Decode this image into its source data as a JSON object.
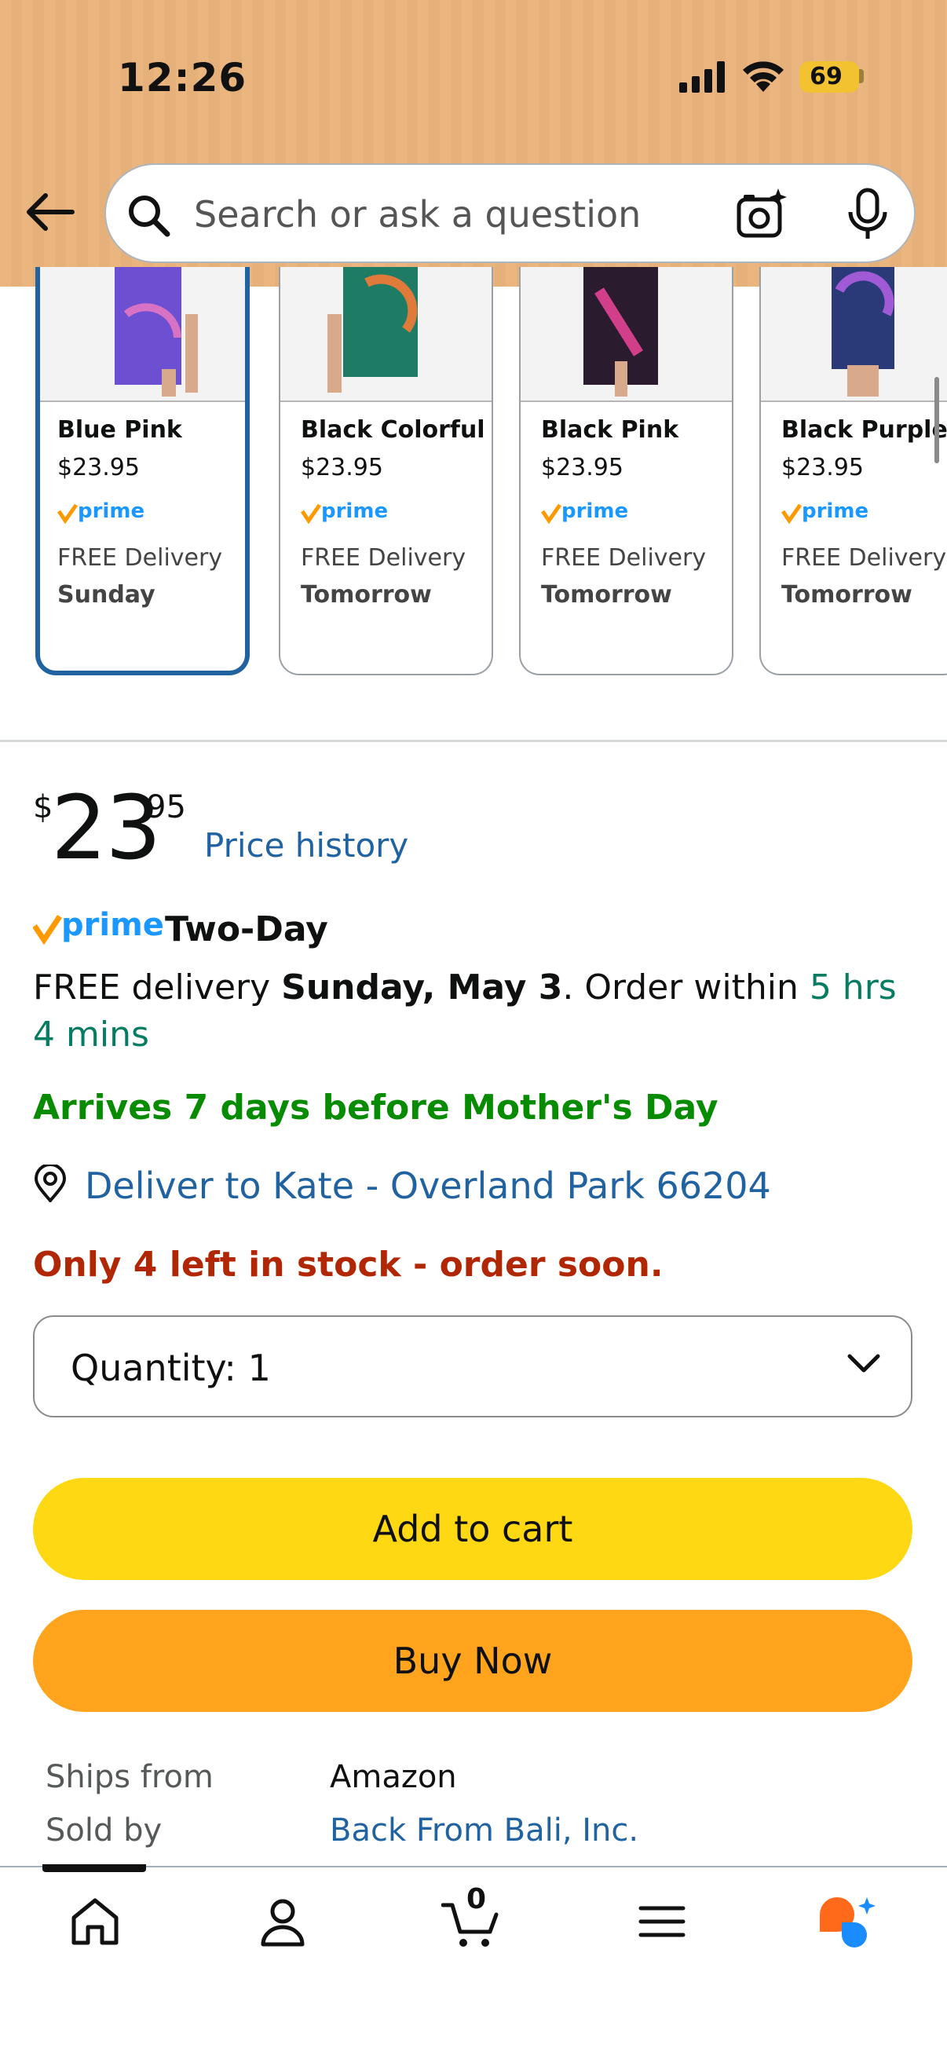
{
  "status_bar": {
    "time": "12:26",
    "battery": "69"
  },
  "search": {
    "placeholder": "Search or ask a question"
  },
  "variants": [
    {
      "name": "Blue Pink",
      "price": "$23.95",
      "delivery": "FREE Delivery",
      "day": "Sunday",
      "selected": true
    },
    {
      "name": "Black Colorful",
      "price": "$23.95",
      "delivery": "FREE Delivery",
      "day": "Tomorrow"
    },
    {
      "name": "Black Pink",
      "price": "$23.95",
      "delivery": "FREE Delivery",
      "day": "Tomorrow"
    },
    {
      "name": "Black Purple",
      "price": "$23.95",
      "delivery": "FREE Delivery",
      "day": "Tomorrow"
    }
  ],
  "prime_word": "prime",
  "price": {
    "symbol": "$",
    "whole": "23",
    "fraction": "95",
    "history_link": "Price history"
  },
  "delivery": {
    "badge_text": "Two-Day",
    "prefix": "FREE delivery ",
    "date": "Sunday, May 3",
    "mid": ". Order within ",
    "countdown": "5 hrs 4 mins",
    "mothers_day": "Arrives 7 days before Mother's Day",
    "deliver_to": "Deliver to Kate - Overland Park 66204",
    "stock": "Only 4 left in stock - order soon."
  },
  "quantity": {
    "label": "Quantity:",
    "value": "1"
  },
  "buttons": {
    "add_to_cart": "Add to cart",
    "buy_now": "Buy Now"
  },
  "seller": {
    "ships_from_label": "Ships from",
    "ships_from": "Amazon",
    "sold_by_label": "Sold by",
    "sold_by": "Back From Bali, Inc."
  },
  "tabbar": {
    "cart_count": "0"
  },
  "colors": {
    "link": "#2162a1",
    "prime_blue": "#1a98ff",
    "add_to_cart": "#ffd814",
    "buy_now": "#ffa41c",
    "stock_red": "#b12704",
    "mothers_green": "#078b00"
  }
}
